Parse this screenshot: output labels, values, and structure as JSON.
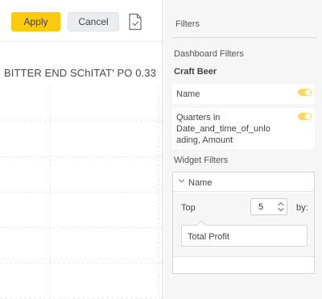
{
  "toolbar": {
    "apply_label": "Apply",
    "cancel_label": "Cancel",
    "export_icon": "document-icon"
  },
  "widget": {
    "title": "BITTER END SChITAT' PO 0.33"
  },
  "filters_panel": {
    "title": "Filters",
    "dashboard_filters_label": "Dashboard Filters",
    "datasource_name": "Craft Beer",
    "dashboard_filters": [
      {
        "name": "Name",
        "enabled": true
      },
      {
        "name_lines": [
          "Quarters in",
          "Date_and_time_of_unlo",
          "ading, Amount"
        ],
        "enabled": true
      }
    ],
    "widget_filters_label": "Widget Filters",
    "widget_filter": {
      "field": "Name",
      "rank_label": "Top",
      "rank_value": "5",
      "by_label": "by:",
      "measure": "Total Profit"
    }
  },
  "colors": {
    "accent": "#ffc90f",
    "toggle_on": "#fbd66a",
    "panel_bg": "#f6f6f6"
  }
}
